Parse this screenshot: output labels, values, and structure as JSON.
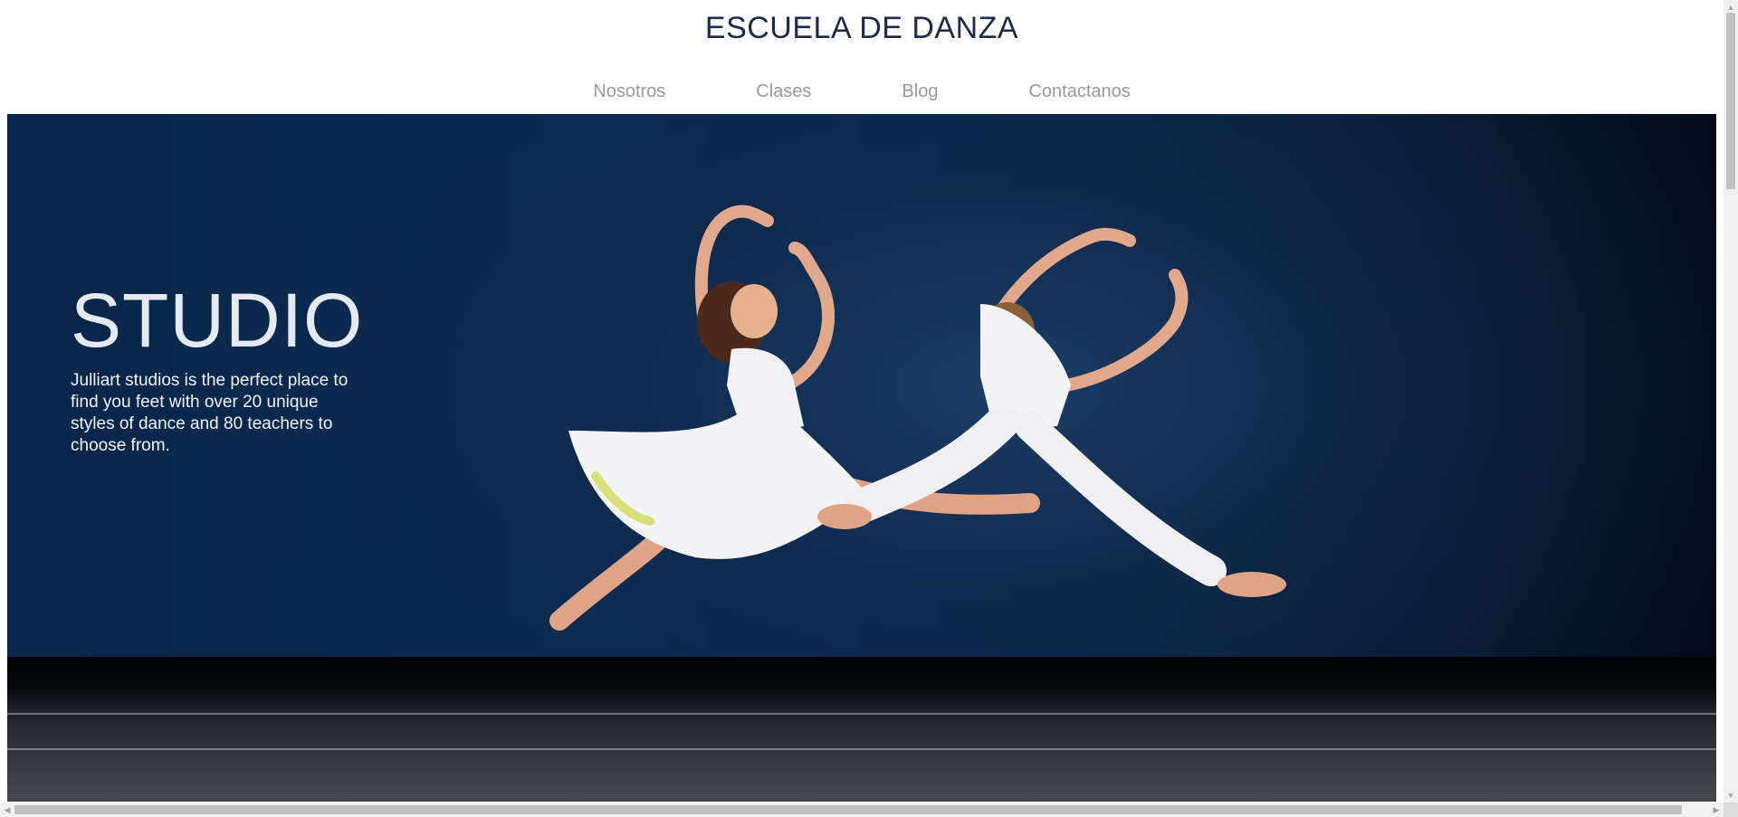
{
  "site": {
    "title": "ESCUELA DE DANZA"
  },
  "nav": {
    "items": [
      {
        "label": "Nosotros"
      },
      {
        "label": "Clases"
      },
      {
        "label": "Blog"
      },
      {
        "label": "Contactanos"
      }
    ]
  },
  "hero": {
    "heading": "STUDIO",
    "text": "Julliart studios is the perfect place to find you feet with over 20 unique styles of dance and 80 teachers to choose from.",
    "image_icon": "dancers-photo"
  },
  "colors": {
    "title": "#1c2b4a",
    "nav": "#9a9a9a",
    "hero_bg": "#0a2b52",
    "hero_text": "#e5eaf2"
  }
}
